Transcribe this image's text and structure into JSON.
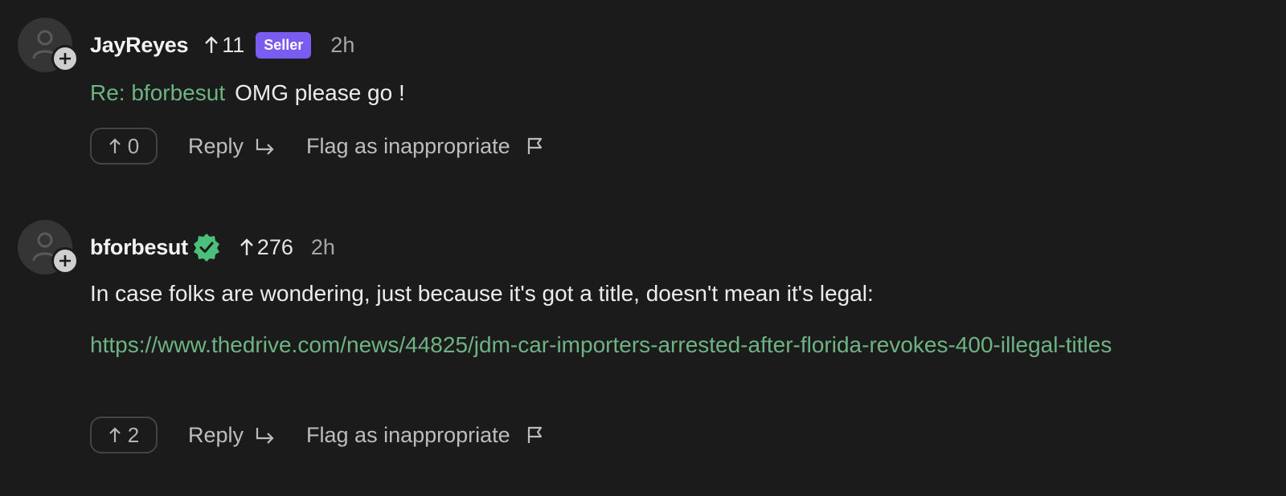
{
  "comments": [
    {
      "username": "JayReyes",
      "score": "11",
      "badge": "Seller",
      "time": "2h",
      "reply_prefix": "Re: bforbesut",
      "text": "OMG please go !",
      "votes": "0",
      "reply_label": "Reply",
      "flag_label": "Flag as inappropriate"
    },
    {
      "username": "bforbesut",
      "verified": true,
      "score": "276",
      "time": "2h",
      "text": "In case folks are wondering, just because it's got a title, doesn't mean it's legal:",
      "link": "https://www.thedrive.com/news/44825/jdm-car-importers-arrested-after-florida-revokes-400-illegal-titles",
      "votes": "2",
      "reply_label": "Reply",
      "flag_label": "Flag as inappropriate"
    }
  ],
  "colors": {
    "background": "#1b1b1b",
    "link": "#6db383",
    "seller_badge": "#7a5cf0",
    "verified": "#4cbf7a"
  },
  "icons": [
    "user-avatar-icon",
    "plus-icon",
    "arrow-up-icon",
    "verified-icon",
    "reply-arrow-icon",
    "flag-icon"
  ]
}
